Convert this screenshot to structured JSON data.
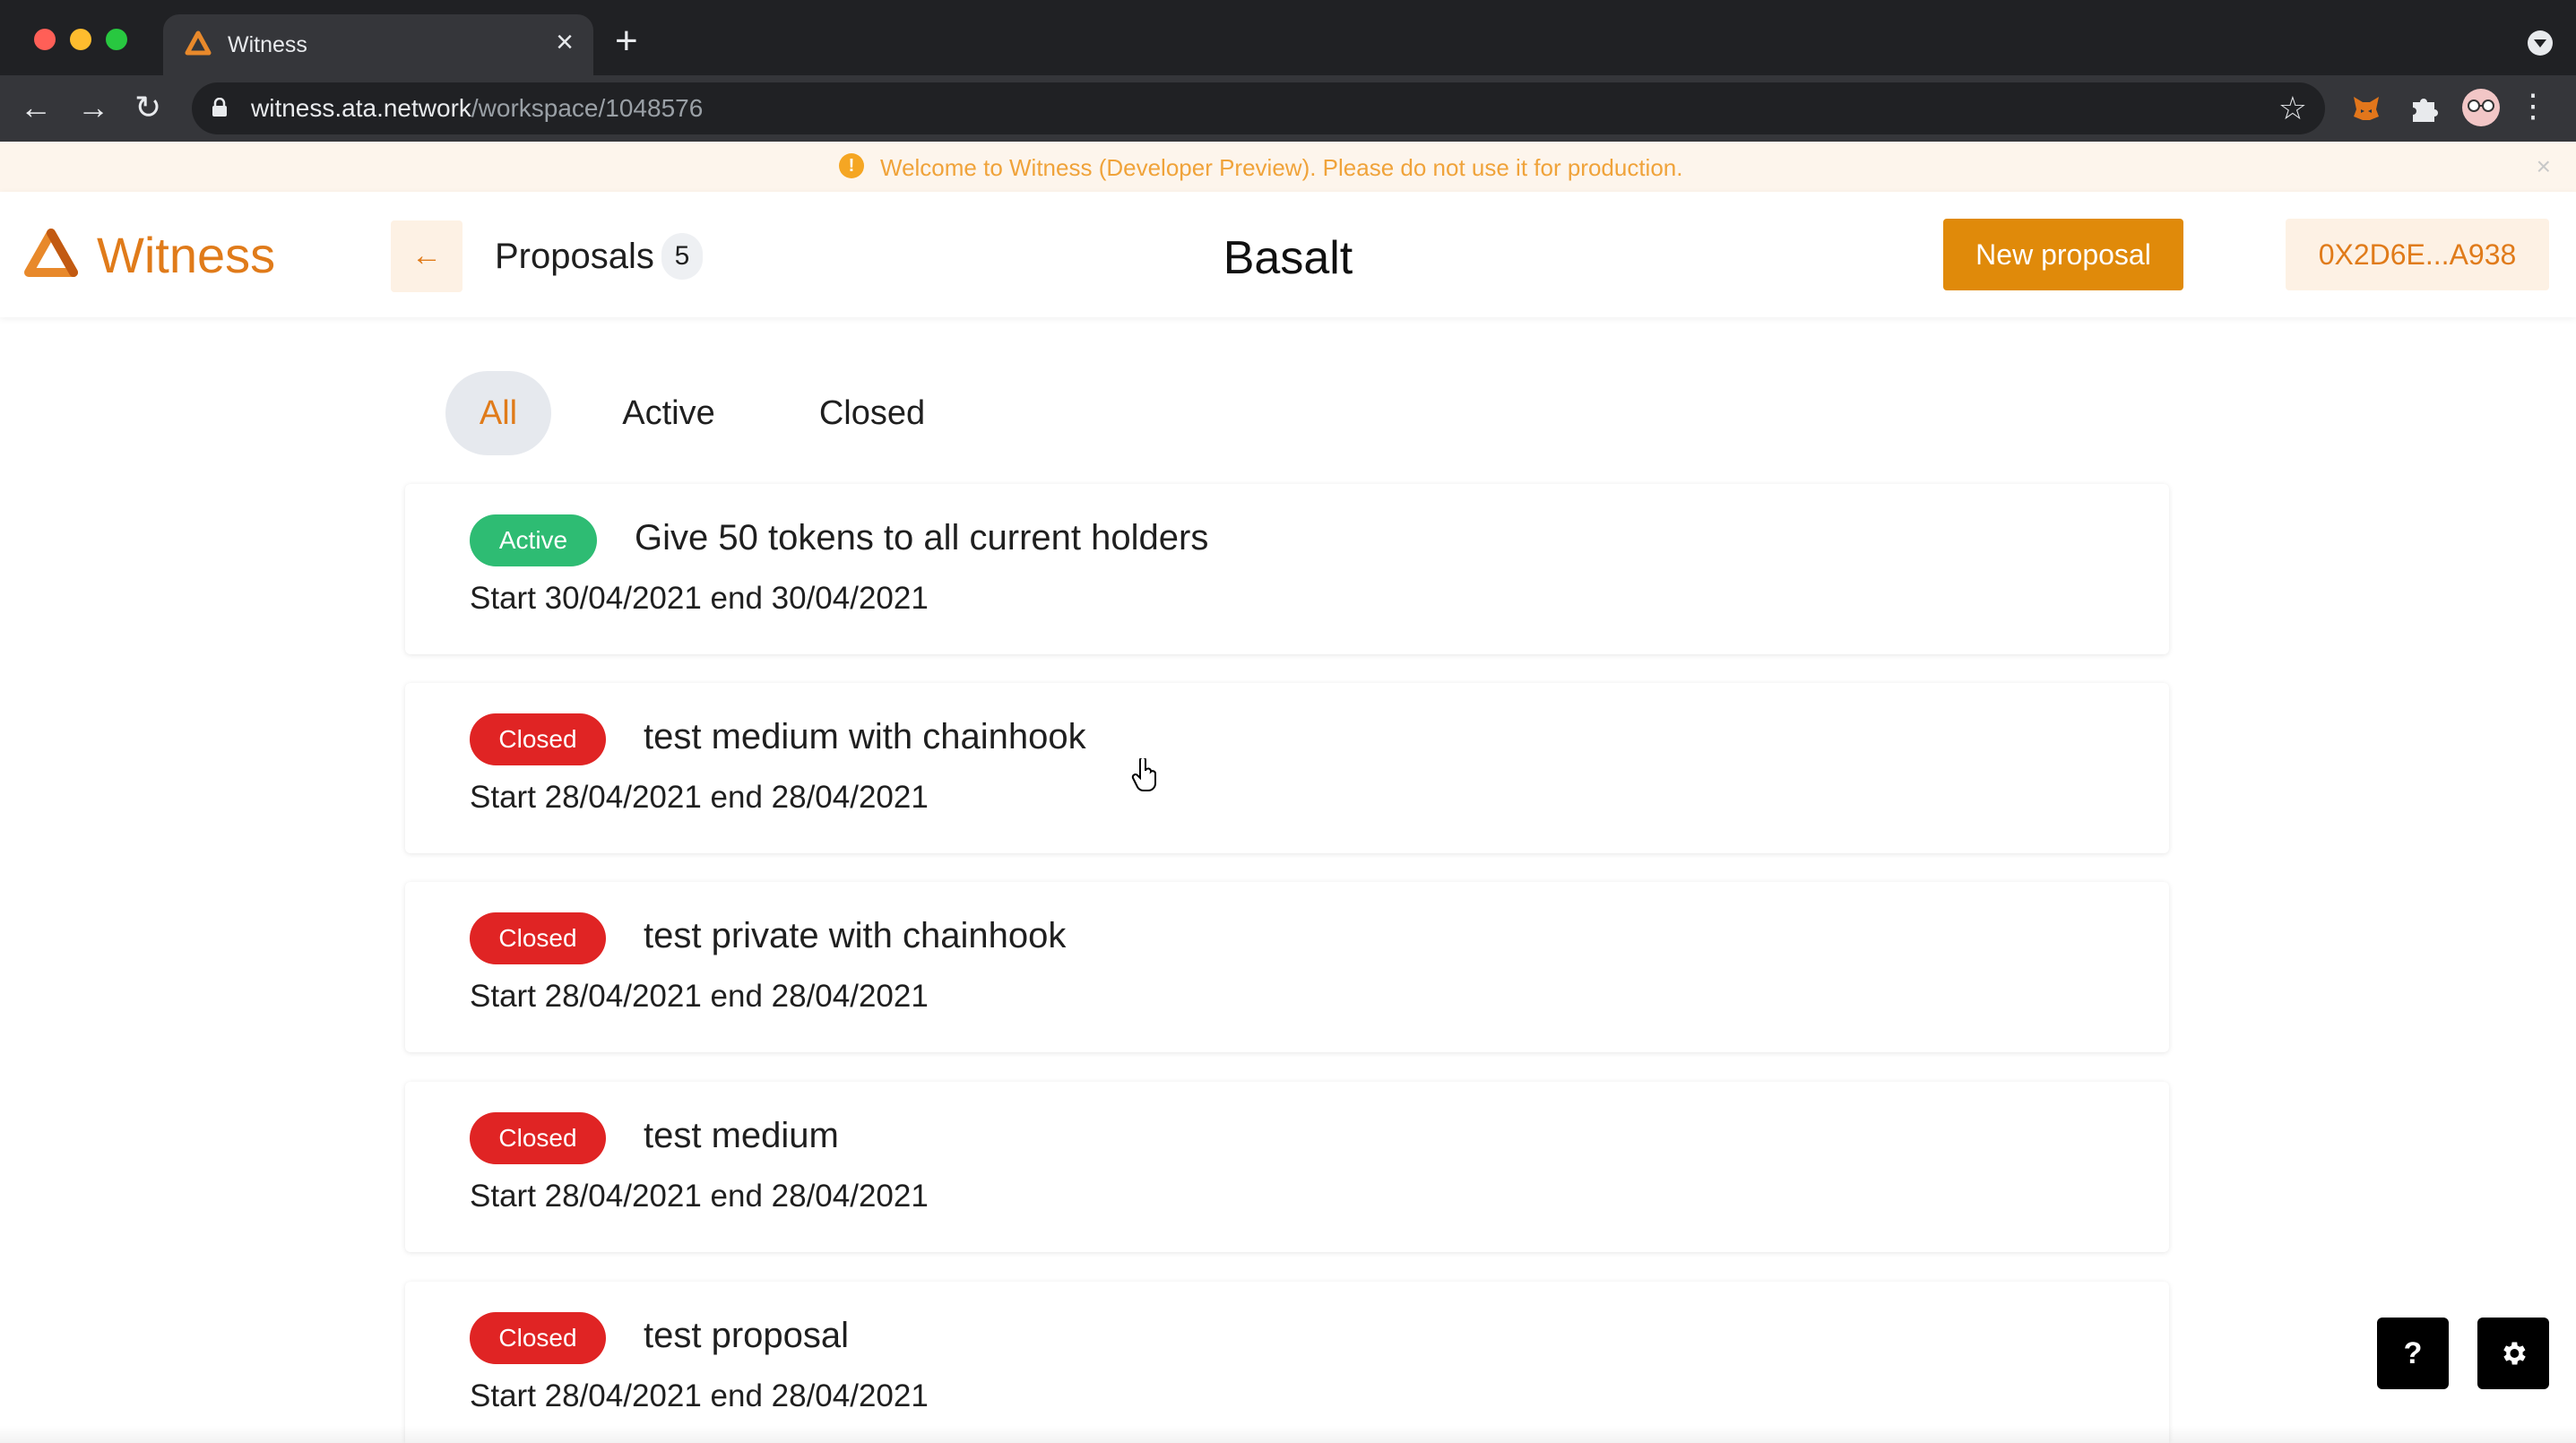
{
  "browser": {
    "tab_title": "Witness",
    "tab_close": "×",
    "new_tab": "+",
    "url_host": "witness.ata.network",
    "url_path": "/workspace/1048576",
    "back": "←",
    "forward": "→",
    "reload": "↻",
    "star": "☆",
    "menu": "⋮"
  },
  "banner": {
    "icon": "!",
    "text": "Welcome to Witness (Developer Preview). Please do not use it for production.",
    "close": "×"
  },
  "header": {
    "app_name": "Witness",
    "back_arrow": "←",
    "proposals_label": "Proposals",
    "proposals_count": "5",
    "workspace_title": "Basalt",
    "new_proposal_label": "New proposal",
    "wallet_address": "0X2D6E...A938"
  },
  "filters": {
    "all": "All",
    "active": "Active",
    "closed": "Closed"
  },
  "proposals": [
    {
      "status": "Active",
      "title": "Give 50 tokens to all current holders",
      "dates": "Start 30/04/2021 end 30/04/2021"
    },
    {
      "status": "Closed",
      "title": "test medium with chainhook",
      "dates": "Start 28/04/2021 end 28/04/2021"
    },
    {
      "status": "Closed",
      "title": "test private with chainhook",
      "dates": "Start 28/04/2021 end 28/04/2021"
    },
    {
      "status": "Closed",
      "title": "test medium",
      "dates": "Start 28/04/2021 end 28/04/2021"
    },
    {
      "status": "Closed",
      "title": "test proposal",
      "dates": "Start 28/04/2021 end 28/04/2021"
    }
  ],
  "floating": {
    "help": "?",
    "settings_icon": "gear-icon"
  },
  "colors": {
    "brand": "#e07b1a",
    "primary_button": "#e08a0a",
    "active_status": "#2ebc73",
    "closed_status": "#e02424",
    "banner_text": "#f0a33a"
  }
}
